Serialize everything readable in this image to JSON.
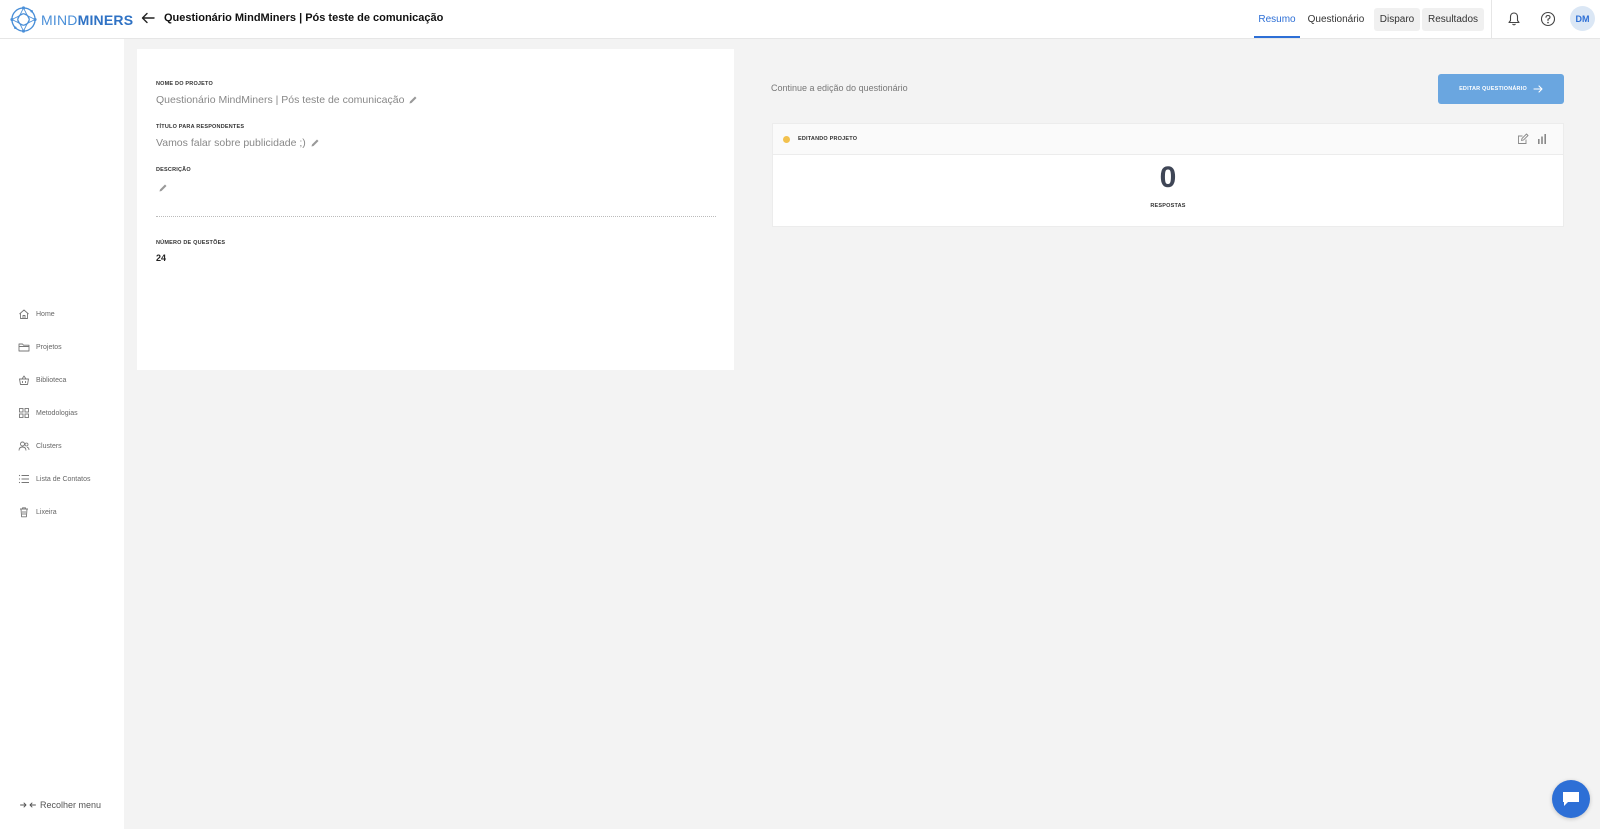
{
  "brand": {
    "logo_part1": "MIND",
    "logo_part2": "MINERS"
  },
  "header": {
    "title": "Questionário MindMiners | Pós teste de comunicação",
    "tabs": [
      {
        "label": "Resumo",
        "active": true
      },
      {
        "label": "Questionário",
        "active": false
      },
      {
        "label": "Disparo",
        "active": false
      },
      {
        "label": "Resultados",
        "active": false
      }
    ],
    "avatar_initials": "DM",
    "icons": {
      "back": "arrow-left-icon",
      "notifications": "bell-icon",
      "help": "help-circle-icon"
    }
  },
  "sidebar": {
    "items": [
      {
        "label": "Home",
        "icon": "home-icon"
      },
      {
        "label": "Projetos",
        "icon": "folder-icon"
      },
      {
        "label": "Biblioteca",
        "icon": "basket-icon"
      },
      {
        "label": "Metodologias",
        "icon": "grid-icon"
      },
      {
        "label": "Clusters",
        "icon": "users-icon"
      },
      {
        "label": "Lista de Contatos",
        "icon": "list-icon"
      },
      {
        "label": "Lixeira",
        "icon": "trash-icon"
      }
    ],
    "collapse_label": "Recolher menu"
  },
  "project_card": {
    "name_label": "NOME DO PROJETO",
    "name_value": "Questionário MindMiners | Pós teste de comunicação",
    "respondent_title_label": "TÍTULO PARA RESPONDENTES",
    "respondent_title_value": "Vamos falar sobre publicidade ;)",
    "description_label": "DESCRIÇÃO",
    "questions_label": "NÚMERO DE QUESTÕES",
    "questions_value": "24"
  },
  "main": {
    "continue_text": "Continue a edição do questionário",
    "edit_button_label": "EDITAR QUESTIONÁRIO"
  },
  "status_card": {
    "status_label": "EDITANDO PROJETO",
    "status_color": "#f2c14e",
    "responses_count": "0",
    "responses_label": "RESPOSTAS"
  },
  "colors": {
    "accent": "#2d6fd6",
    "button": "#6aa6e0"
  }
}
